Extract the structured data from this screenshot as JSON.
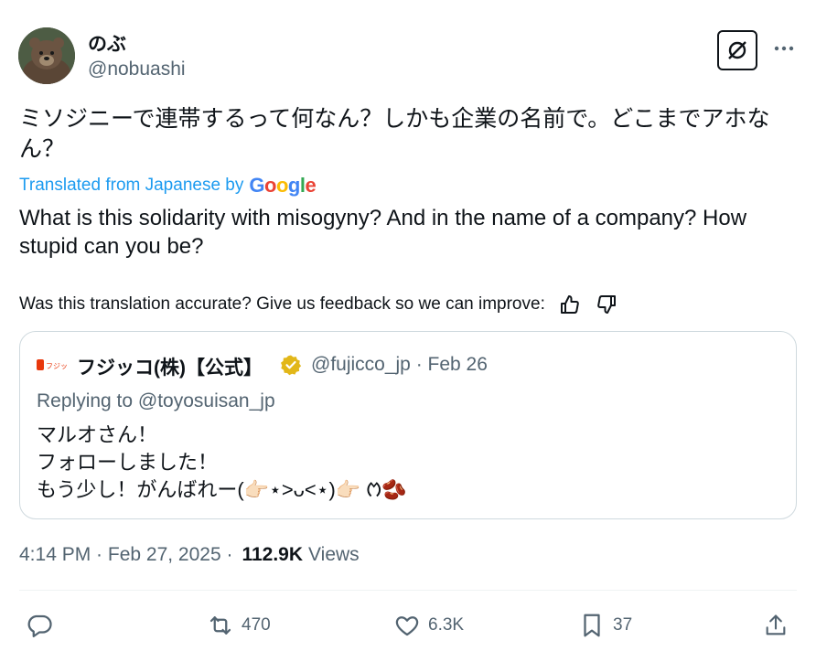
{
  "author": {
    "display_name": "のぶ",
    "handle": "@nobuashi"
  },
  "tweet": {
    "text": "ミソジニーで連帯するって何なん？しかも企業の名前で。どこまでアホなん？",
    "translated_from": "Translated from Japanese by",
    "translation_provider": "Google",
    "translation": "What is this solidarity with misogyny? And in the name of a company? How stupid can you be?",
    "feedback_prompt": "Was this translation accurate? Give us feedback so we can improve:"
  },
  "quoted_tweet": {
    "display_name": "フジッコ(株)【公式】",
    "handle_date": "@fujicco_jp · Feb 26",
    "replying_to": "Replying to @toyosuisan_jp",
    "body": "マルオさん！\nフォローしました！\nもう少し！がんばれー(👉🏻⋆>ᴗ<⋆)👉🏻 ᱬ🫘",
    "logo_text": "フジッコ"
  },
  "meta": {
    "time_date": "4:14 PM · Feb 27, 2025 ·",
    "views_count": "112.9K",
    "views_label": "Views"
  },
  "actions": {
    "reply_icon": "reply-icon",
    "retweets": "470",
    "likes": "6.3K",
    "bookmarks": "37",
    "share_icon": "share-icon"
  },
  "colors": {
    "link_blue": "#1d9bf0",
    "secondary_text": "#536471",
    "border": "#cfd9de",
    "verified_gold": "#e2b719"
  }
}
